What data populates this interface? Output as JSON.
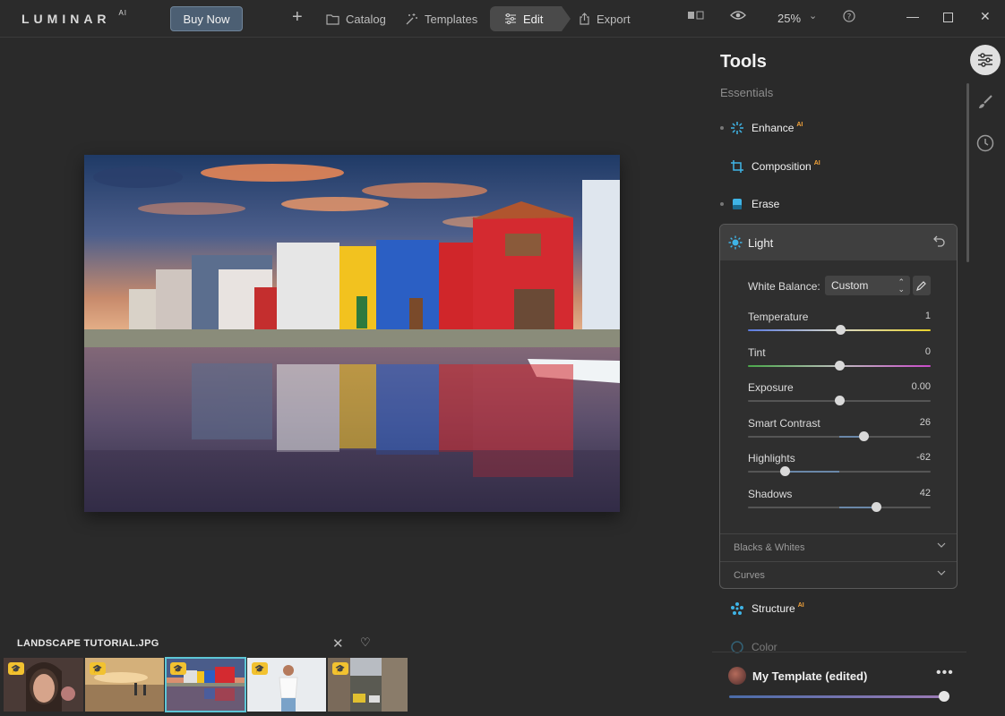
{
  "app": {
    "logo": "LUMINAR",
    "logo_ai": "AI",
    "buy_label": "Buy Now",
    "nav": {
      "catalog": "Catalog",
      "templates": "Templates",
      "edit": "Edit",
      "export": "Export"
    },
    "zoom": "25%"
  },
  "filmstrip": {
    "title": "LANDSCAPE TUTORIAL.JPG",
    "thumbs": [
      {
        "name": "portrait-woman",
        "selected": false
      },
      {
        "name": "beach-sunset",
        "selected": false
      },
      {
        "name": "landscape-tutorial",
        "selected": true
      },
      {
        "name": "woman-white-shirt",
        "selected": false
      },
      {
        "name": "city-street",
        "selected": false
      }
    ]
  },
  "panel": {
    "title": "Tools",
    "section": "Essentials",
    "tools": {
      "enhance": "Enhance",
      "composition": "Composition",
      "erase": "Erase",
      "structure": "Structure",
      "color": "Color"
    },
    "ai_badge": "AI",
    "light": {
      "title": "Light",
      "white_balance_label": "White Balance:",
      "white_balance_value": "Custom",
      "sliders": [
        {
          "label": "Temperature",
          "value": "1",
          "position": 0.505
        },
        {
          "label": "Tint",
          "value": "0",
          "position": 0.5
        },
        {
          "label": "Exposure",
          "value": "0.00",
          "position": 0.5
        },
        {
          "label": "Smart Contrast",
          "value": "26",
          "position": 0.63
        },
        {
          "label": "Highlights",
          "value": "-62",
          "position": 0.2
        },
        {
          "label": "Shadows",
          "value": "42",
          "position": 0.7
        }
      ],
      "subsections": [
        "Blacks & Whites",
        "Curves"
      ]
    }
  },
  "template": {
    "name": "My Template (edited)",
    "amount": 1.0
  },
  "colors": {
    "accent": "#5ec6d6",
    "buy_button": "#4c5f73",
    "ai_badge": "#f2a33a"
  }
}
